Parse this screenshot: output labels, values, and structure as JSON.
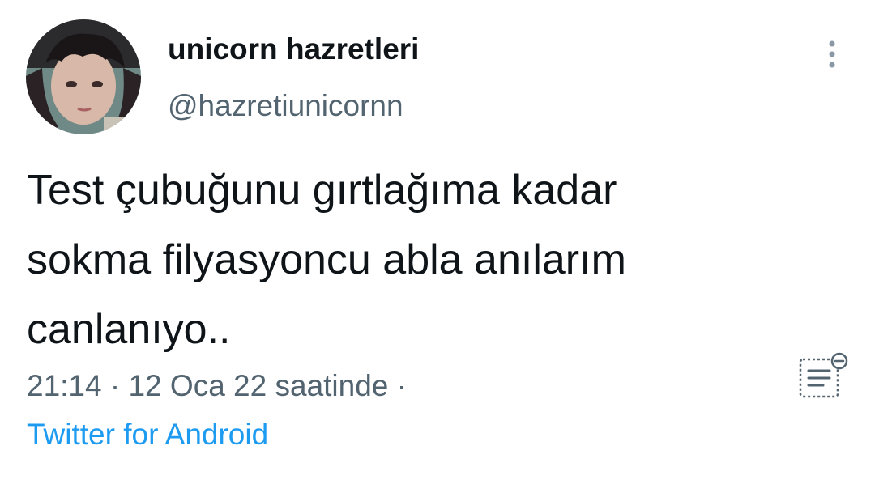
{
  "author": {
    "display_name": "unicorn hazretleri",
    "handle": "@hazretiunicornn"
  },
  "tweet": {
    "text": "Test çubuğunu gırtlağıma kadar\nsokma filyasyoncu abla anılarım\ncanlanıyo.."
  },
  "meta": {
    "time": "21:14",
    "separator": " · ",
    "date": "12 Oca 22 saatinde",
    "trailing_separator": " ·"
  },
  "source": {
    "label": "Twitter for Android"
  },
  "icons": {
    "more": "more-vertical-icon",
    "notes": "notes-icon"
  },
  "colors": {
    "text": "#0f1419",
    "secondary": "#536471",
    "link": "#1d9bf0"
  }
}
